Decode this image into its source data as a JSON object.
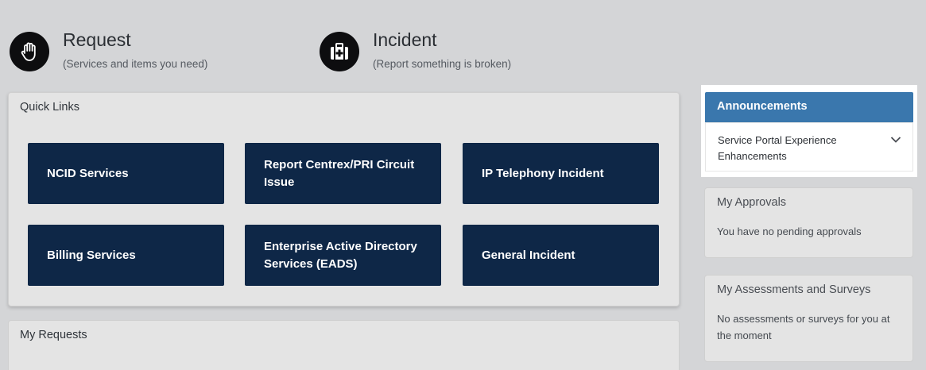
{
  "actions": {
    "request": {
      "title": "Request",
      "subtitle": "(Services and items you need)"
    },
    "incident": {
      "title": "Incident",
      "subtitle": "(Report something is broken)"
    }
  },
  "quick_links": {
    "heading": "Quick Links",
    "tiles": [
      "NCID Services",
      "Report Centrex/PRI Circuit Issue",
      "IP Telephony Incident",
      "Billing Services",
      "Enterprise Active Directory Services (EADS)",
      "General Incident"
    ]
  },
  "my_requests": {
    "heading": "My Requests"
  },
  "announcements": {
    "heading": "Announcements",
    "items": [
      "Service Portal Experience Enhancements"
    ]
  },
  "approvals": {
    "heading": "My Approvals",
    "message": "You have no pending approvals"
  },
  "assessments": {
    "heading": "My Assessments and Surveys",
    "message": "No assessments or surveys for you at the moment"
  },
  "colors": {
    "page_bg": "#d4d5d7",
    "tile_bg": "#0e2747",
    "announce_header": "#3a77ad"
  },
  "icons": {
    "request": "raised-hand-icon",
    "incident": "first-aid-kit-icon",
    "announcement_toggle": "chevron-down-icon"
  }
}
